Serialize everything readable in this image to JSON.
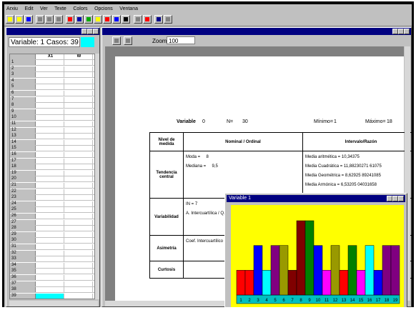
{
  "menu": [
    "Arxiu",
    "Edit",
    "Ver",
    "Texte",
    "Colors",
    "Opcions",
    "Ventana"
  ],
  "left_window": {
    "title": "",
    "variable_label": "Variable: 1 Casos: 39",
    "col1_header": "X1",
    "col2_header": "W",
    "rows": [
      "1",
      "2",
      "3",
      "4",
      "5",
      "6",
      "7",
      "8",
      "9",
      "10",
      "11",
      "12",
      "13",
      "14",
      "15",
      "16",
      "17",
      "18",
      "19",
      "20",
      "21",
      "22",
      "23",
      "24",
      "25",
      "26",
      "27",
      "28",
      "29",
      "30",
      "31",
      "32",
      "33",
      "34",
      "35",
      "36",
      "37",
      "38",
      "39"
    ]
  },
  "right_window": {
    "title": "",
    "zoom_label": "Zoom",
    "zoom_value": "100"
  },
  "report": {
    "var_label": "Variable",
    "var_value": "0",
    "n_label": "N=",
    "n_value": "30",
    "min_label": "Mínimo=",
    "min_value": "1",
    "max_label": "Máximo=",
    "max_value": "18",
    "headers": {
      "nivel": "Nivel de medida",
      "nominal": "Nominal / Ordinal",
      "intervalo": "Intervalo/Razón"
    },
    "tendencia": {
      "label": "Tendencia central",
      "moda": "Moda =",
      "moda_val": "8",
      "mediana": "Mediana =",
      "mediana_val": "9,5",
      "lines": [
        "Media aritmética =    10,34375",
        "Media Cuadrática =   11,88230271 61075",
        "Media Geométrica =   8,62925 89241085",
        "Media Armónica =    6,53205 04031658"
      ]
    },
    "variabilidad": {
      "label": "Variabilidad",
      "l1": "IN =   7",
      "l2": "A. Intercuartílica / Q.Desv ="
    },
    "asimetria": {
      "label": "Asimetría",
      "l1": "Coef. Intercuartílico ="
    },
    "curtosis": {
      "label": "Curtosis"
    }
  },
  "chart_window": {
    "title": "Variable 1"
  },
  "chart_data": {
    "type": "bar",
    "categories": [
      "1",
      "2",
      "3",
      "4",
      "5",
      "6",
      "7",
      "8",
      "9",
      "10",
      "11",
      "12",
      "13",
      "14",
      "15",
      "16",
      "17",
      "18",
      "19"
    ],
    "values": [
      1,
      1,
      2,
      1,
      2,
      2,
      1,
      3,
      3,
      2,
      1,
      2,
      1,
      2,
      1,
      2,
      1,
      2,
      2
    ],
    "colors": [
      "#ff0000",
      "#ff0000",
      "#0000ff",
      "#00ffff",
      "#800080",
      "#999900",
      "#800000",
      "#800000",
      "#008000",
      "#0000ff",
      "#ff00ff",
      "#999900",
      "#ff0000",
      "#008000",
      "#ff00ff",
      "#00ffff",
      "#0000ff",
      "#800080",
      "#800080"
    ],
    "ylim": [
      0,
      3
    ]
  }
}
